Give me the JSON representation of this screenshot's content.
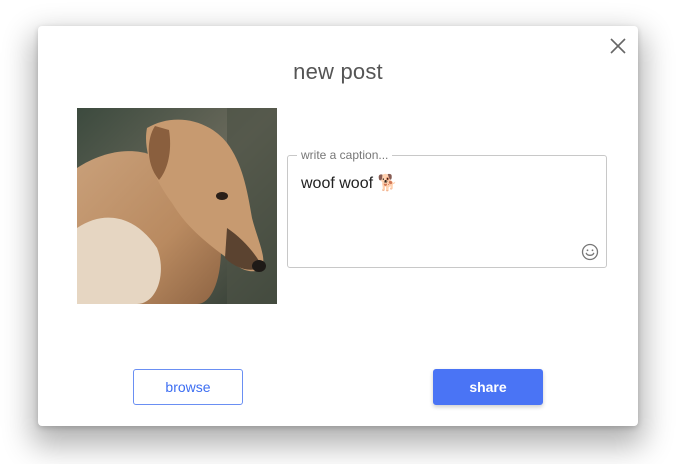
{
  "dialog": {
    "title": "new post",
    "caption": {
      "placeholder": "write a caption...",
      "value": "woof woof 🐕"
    },
    "photo_alt": "dog photo",
    "buttons": {
      "browse_label": "browse",
      "share_label": "share"
    }
  },
  "icons": {
    "close": "close-icon",
    "emoji": "smiley-icon"
  },
  "colors": {
    "accent": "#4a74f5",
    "browse_border": "#6a8ff3",
    "text": "#222222",
    "muted": "#777777"
  }
}
